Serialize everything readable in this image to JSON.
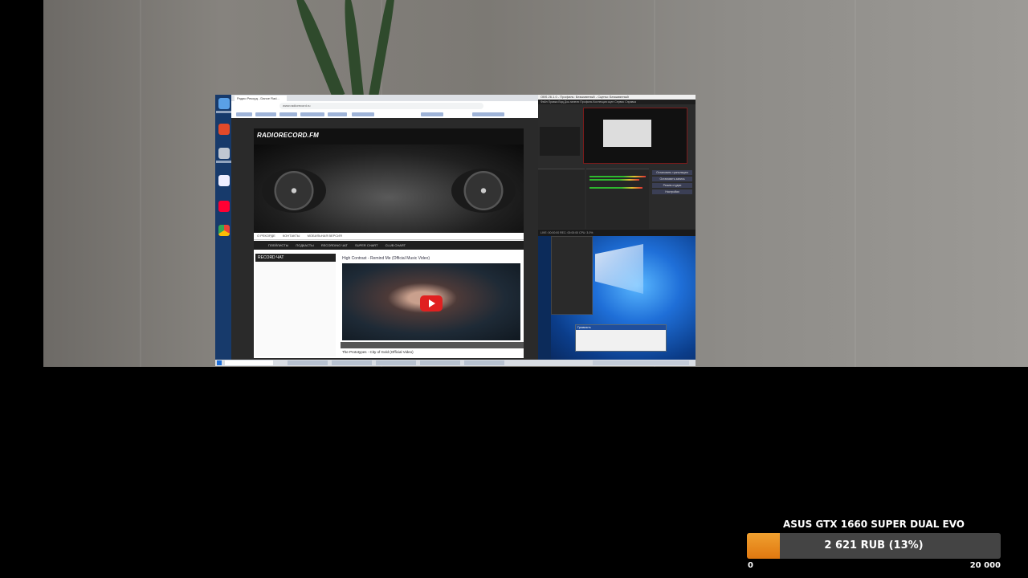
{
  "browser": {
    "tab_title": "Радио Рекорд - Dance Rad...",
    "url": "www.radiorecord.ru",
    "site_logo": "RADIORECORD.FM",
    "site_nav": [
      "О РЕКОРДЕ",
      "КОНТАКТЫ",
      "МОБИЛЬНАЯ ВЕРСИЯ"
    ],
    "site_menu": [
      "ПЛЕЙЛИСТЫ",
      "ПОДКАСТЫ",
      "RECORDING ЧАТ",
      "SUPER CHART",
      "CLUB CHART"
    ],
    "left_box_title": "RECORD ЧАТ",
    "video_title": "High Contrast - Remind Me (Official Music Video)",
    "next_video": "The Prototypes - City of Gold (Official Video)"
  },
  "obs": {
    "window_title": "OBS 26.1.0 - Профиль: Безымянный - Сцены: Безымянный",
    "menu": "Файл  Правка  Вид  Док-панели  Профиль  Коллекция сцен  Сервис  Справка",
    "buttons": [
      "Остановить трансляцию",
      "Остановить запись",
      "Режим студии",
      "Настройки"
    ],
    "status": "LIVE: 00:00:00  REC: 00:00:00  CPU: 3.0%"
  },
  "volume_dialog": {
    "title": "Громкость"
  },
  "overlay": {
    "title": "ASUS GTX 1660 SUPER DUAL EVO",
    "progress_label": "2 621 RUB (13%)",
    "progress_fraction": 0.13,
    "min_label": "0",
    "max_label": "20 000",
    "accent": "#f08c1e"
  }
}
